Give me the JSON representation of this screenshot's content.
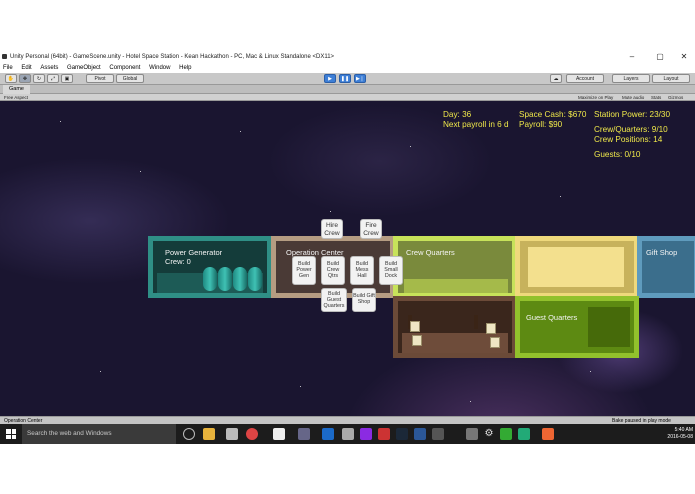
{
  "window": {
    "title": "Unity Personal (64bit) - GameScene.unity - Hotel Space Station - Kean Hackathon - PC, Mac & Linux Standalone <DX11>",
    "minimize": "‒",
    "maximize": "▢",
    "close": "✕"
  },
  "menu": [
    "File",
    "Edit",
    "Assets",
    "GameObject",
    "Component",
    "Window",
    "Help"
  ],
  "toolbar": {
    "pivot": "Pivot",
    "global": "Global",
    "account": "Account",
    "layers": "Layers",
    "layout": "Layout"
  },
  "game_tab": {
    "label": "Game",
    "aspect": "Free Aspect",
    "maximize": "Maximize on Play",
    "mute": "Mute audio",
    "stats": "Stats",
    "gizmos": "Gizmos"
  },
  "hud": {
    "day": "Day: 36",
    "payroll_due": "Next payroll in 6 d",
    "space_cash": "Space Cash: $670",
    "payroll": "Payroll: $90",
    "station_power": "Station Power: 23/30",
    "crew_quarters": "Crew/Quarters: 9/10",
    "crew_positions": "Crew Positions: 14",
    "guests": "Guests: 0/10"
  },
  "rooms": {
    "power_generator": {
      "title": "Power Generator",
      "crew": "Crew: 0"
    },
    "operation_center": {
      "title": "Operation Center"
    },
    "crew_quarters": {
      "title": "Crew Quarters"
    },
    "gift_shop": {
      "title": "Gift Shop"
    },
    "guest_quarters": {
      "title": "Guest Quarters"
    }
  },
  "buttons": {
    "hire_crew": "Hire Crew",
    "fire_crew": "Fire Crew",
    "build_power_gen": "Build Power Gen",
    "build_crew_qtrs": "Build Crew Qtrs",
    "build_mess_hall": "Build Mess Hall",
    "build_small_dock": "Build Small Dock",
    "build_guest_quarters": "Build Guest Quarters",
    "build_gift_shop": "Build Gift Shop"
  },
  "status": {
    "selected": "Operation Center",
    "bake": "Bake paused in play mode"
  },
  "taskbar": {
    "search_placeholder": "Search the web and Windows",
    "time": "5:40 AM",
    "date": "2016-05-08"
  },
  "colors": {
    "power_room": "#2f8f86",
    "ops_room": "#b59c82",
    "crew_room": "#c7e25a",
    "yellow_room": "#efd97c",
    "gift_room": "#5f9bbd",
    "guest_room": "#92c12c",
    "hud_text": "#f0e94a",
    "play_button": "#3e7fd6"
  }
}
